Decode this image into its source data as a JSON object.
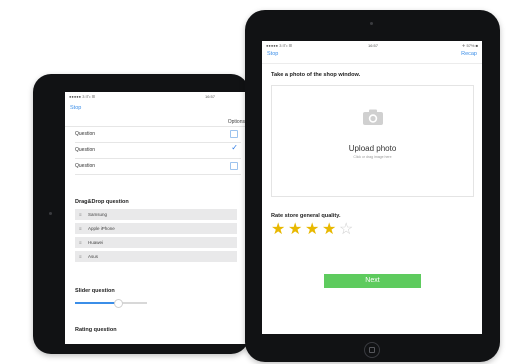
{
  "left_tablet": {
    "status_bar": {
      "carrier": "●●●●● 3 IT• ☰",
      "time": "16:57"
    },
    "nav": {
      "back_label": "Stop"
    },
    "options_header": "Options",
    "questions": [
      {
        "label": "Question",
        "checked": false
      },
      {
        "label": "Question",
        "checked": true
      },
      {
        "label": "Question",
        "checked": false
      }
    ],
    "check_mark": "✓",
    "dragdrop": {
      "title": "Drag&Drop question",
      "handle_icon": "≡",
      "items": [
        "Samsung",
        "Apple iPhone",
        "Huawei",
        "Asus"
      ]
    },
    "slider": {
      "title": "Slider question",
      "level": 0.6
    },
    "rating_title": "Rating question"
  },
  "right_tablet": {
    "status_bar": {
      "carrier": "●●●●● 3 IT• ☰",
      "time": "16:57",
      "battery": "✈ 57% ■"
    },
    "nav": {
      "left_label": "Stop",
      "right_label": "Recap"
    },
    "photo_prompt": "Take a photo of the shop window.",
    "upload": {
      "icon": "camera-icon",
      "title": "Upload photo",
      "hint": "Click or drag image here"
    },
    "rating": {
      "title": "Rate store general quality.",
      "value": 4,
      "max": 5
    },
    "next_label": "Next",
    "colors": {
      "accent": "#3b8ee8",
      "next_bg": "#5ecb5e",
      "star": "#e8b800",
      "bezel": "#111214"
    }
  }
}
